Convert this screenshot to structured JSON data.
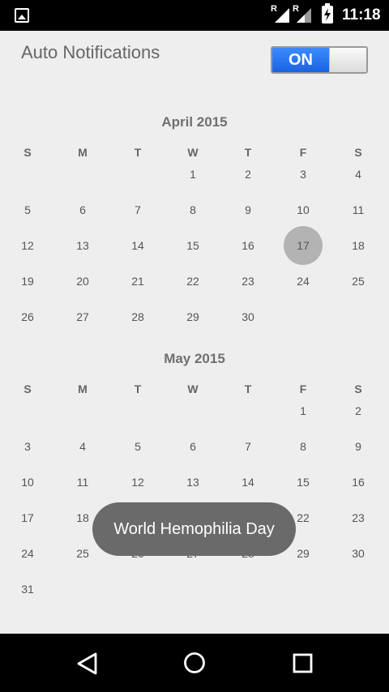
{
  "status_bar": {
    "time": "11:18",
    "roaming_label_1": "R",
    "roaming_label_2": "R",
    "icons": [
      "gallery-icon",
      "signal-roaming-icon",
      "signal-roaming-icon",
      "battery-charging-icon"
    ]
  },
  "settings": {
    "auto_notifications_label": "Auto Notifications",
    "toggle_label": "ON",
    "toggle_on": true,
    "accent_color": "#1a63e0"
  },
  "calendar": {
    "weekday_headers": [
      "S",
      "M",
      "T",
      "W",
      "T",
      "F",
      "S"
    ],
    "months": [
      {
        "title": "April 2015",
        "first_weekday": 3,
        "days_in_month": 30,
        "selected_day": "17"
      },
      {
        "title": "May 2015",
        "first_weekday": 5,
        "days_in_month": 31,
        "selected_day": null
      }
    ]
  },
  "toast": {
    "text": "World Hemophilia Day"
  },
  "nav_bar": {
    "icons": [
      "back-icon",
      "home-icon",
      "recents-icon"
    ]
  }
}
